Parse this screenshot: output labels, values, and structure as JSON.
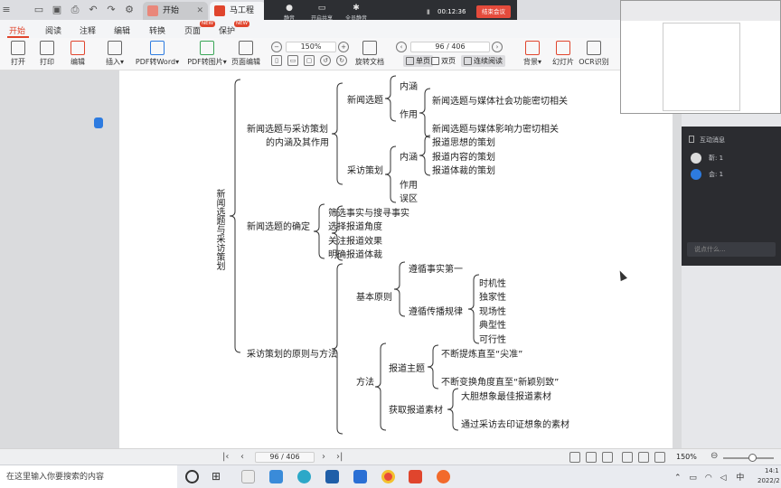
{
  "titlebar": {
    "tabs": [
      {
        "label": "开始",
        "icon": "home-icon"
      },
      {
        "label": "马工程《新",
        "icon": "pdf-icon"
      }
    ]
  },
  "meeting": {
    "items": [
      {
        "label": "静音",
        "icon": "microphone-icon"
      },
      {
        "label": "开启共享",
        "icon": "share-screen-icon"
      },
      {
        "label": "全员静音",
        "icon": "mute-all-icon"
      }
    ],
    "time": "00:12:36",
    "end_label": "结束会议"
  },
  "menu": {
    "tabs": [
      "开始",
      "阅读",
      "注释",
      "编辑",
      "转换",
      "页面",
      "保护"
    ],
    "new_badge": "NEW"
  },
  "toolbar": {
    "open": "打开",
    "print": "打印",
    "edit": "编辑",
    "insert": "插入",
    "pdf_to_word": "PDF转Word",
    "pdf_to_image": "PDF转图片",
    "page_edit": "页面编辑",
    "zoom": "150%",
    "page_indicator": "96 / 406",
    "rotate_doc": "旋转文档",
    "single_page": "单页",
    "double_page": "双页",
    "continuous": "连续阅读",
    "background": "背景",
    "slideshow": "幻灯片",
    "ocr": "OCR识别"
  },
  "mindmap": {
    "root": "新闻选题与采访策划",
    "b1": "新闻选题与采访策划",
    "b1b": "的内涵及其作用",
    "b1_news": "新闻选题",
    "b1_news_c1": "内涵",
    "b1_news_c2": "作用",
    "b1_news_c2_a": "新闻选题与媒体社会功能密切相关",
    "b1_news_c2_b": "新闻选题与媒体影响力密切相关",
    "b1_interview": "采访策划",
    "b1_int_c1": "内涵",
    "b1_int_c1_a": "报道思想的策划",
    "b1_int_c1_b": "报道内容的策划",
    "b1_int_c1_c": "报道体裁的策划",
    "b1_int_c2": "作用",
    "b1_int_c3": "误区",
    "b2": "新闻选题的确定",
    "b2_a": "筛选事实与搜寻事实",
    "b2_b": "选择报道角度",
    "b2_c": "关注报道效果",
    "b2_d": "明确报道体裁",
    "b3": "采访策划的原则与方法",
    "b3_principle": "基本原则",
    "b3_p1": "遵循事实第一",
    "b3_p2": "遵循传播规律",
    "b3_p2_a": "时机性",
    "b3_p2_b": "独家性",
    "b3_p2_c": "现场性",
    "b3_p2_d": "典型性",
    "b3_p2_e": "可行性",
    "b3_method": "方法",
    "b3_m1": "报道主题",
    "b3_m1_a": "不断提炼直至“尖准”",
    "b3_m1_b": "不断变换角度直至“新颖别致”",
    "b3_m2": "获取报道素材",
    "b3_m2_a": "大胆想象最佳报道素材",
    "b3_m2_b": "通过采访去印证想象的素材"
  },
  "side_panel": {
    "title": "互动消息",
    "rows": [
      {
        "name": "靳: 1"
      },
      {
        "name": "会: 1"
      }
    ],
    "input_placeholder": "说点什么..."
  },
  "statusbar": {
    "page_indicator": "96 / 406",
    "zoom": "150%"
  },
  "taskbar": {
    "search_placeholder": "在这里输入你要搜索的内容",
    "ime": "中",
    "time": "14:1",
    "date": "2022/2"
  }
}
